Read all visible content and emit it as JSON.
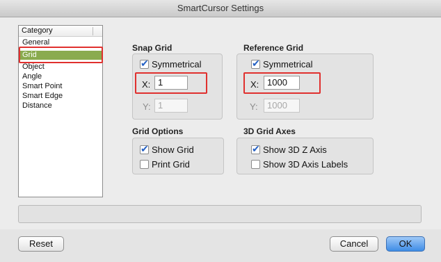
{
  "window": {
    "title": "SmartCursor Settings"
  },
  "category": {
    "header": "Category",
    "items": [
      "General",
      "Grid",
      "Object",
      "Angle",
      "Smart Point",
      "Smart Edge",
      "Distance"
    ],
    "selected": "Grid"
  },
  "snap_grid": {
    "label": "Snap Grid",
    "symmetrical_label": "Symmetrical",
    "symmetrical_checked": true,
    "x_label": "X:",
    "x_value": "1",
    "y_label": "Y:",
    "y_value": "1"
  },
  "reference_grid": {
    "label": "Reference Grid",
    "symmetrical_label": "Symmetrical",
    "symmetrical_checked": true,
    "x_label": "X:",
    "x_value": "1000",
    "y_label": "Y:",
    "y_value": "1000"
  },
  "grid_options": {
    "label": "Grid Options",
    "show_grid_label": "Show Grid",
    "show_grid_checked": true,
    "print_grid_label": "Print Grid",
    "print_grid_checked": false
  },
  "grid_axes_3d": {
    "label": "3D Grid Axes",
    "show_z_label": "Show 3D Z Axis",
    "show_z_checked": true,
    "show_labels_label": "Show 3D Axis Labels",
    "show_labels_checked": false
  },
  "buttons": {
    "reset": "Reset",
    "cancel": "Cancel",
    "ok": "OK"
  },
  "colors": {
    "selection": "#8aab4f",
    "highlight": "#e0302e",
    "default_button": "#3f8de6"
  }
}
